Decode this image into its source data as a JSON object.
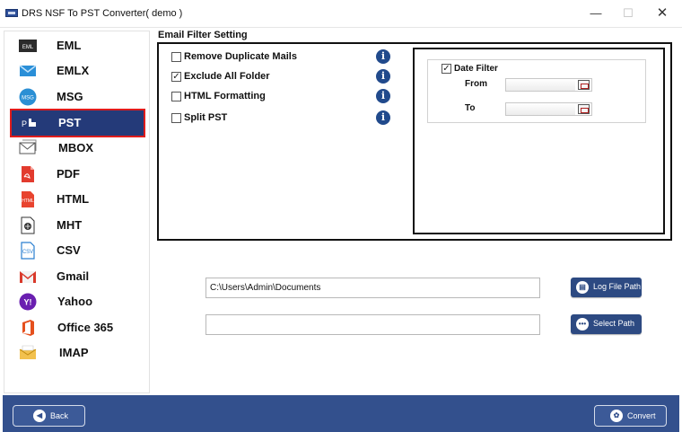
{
  "window": {
    "title": "DRS NSF To PST Converter( demo )",
    "minimize": "—",
    "maximize": "☐",
    "close": "✕"
  },
  "sidebar": {
    "items": [
      {
        "label": "EML",
        "icon": "eml-file-icon"
      },
      {
        "label": "EMLX",
        "icon": "envelope-icon"
      },
      {
        "label": "MSG",
        "icon": "msg-file-icon"
      },
      {
        "label": "PST",
        "icon": "pst-file-icon",
        "selected": true
      },
      {
        "label": "MBOX",
        "icon": "mbox-envelope-icon"
      },
      {
        "label": "PDF",
        "icon": "pdf-file-icon"
      },
      {
        "label": "HTML",
        "icon": "html-file-icon"
      },
      {
        "label": "MHT",
        "icon": "mht-file-icon"
      },
      {
        "label": "CSV",
        "icon": "csv-file-icon"
      },
      {
        "label": "Gmail",
        "icon": "gmail-icon"
      },
      {
        "label": "Yahoo",
        "icon": "yahoo-icon"
      },
      {
        "label": "Office 365",
        "icon": "office365-icon"
      },
      {
        "label": "IMAP",
        "icon": "imap-icon"
      }
    ]
  },
  "filter": {
    "section_title": "Email Filter Setting",
    "options": [
      {
        "label": "Remove Duplicate Mails",
        "checked": false
      },
      {
        "label": "Exclude All Folder",
        "checked": true
      },
      {
        "label": "HTML Formatting",
        "checked": false
      },
      {
        "label": "Split PST",
        "checked": false
      }
    ],
    "info_glyph": "i",
    "date_filter": {
      "label": "Date Filter",
      "checked": true,
      "from_label": "From",
      "to_label": "To",
      "from_value": "",
      "to_value": ""
    }
  },
  "paths": {
    "log_path_value": "C:\\Users\\Admin\\Documents",
    "log_button": "Log File Path",
    "destination_value": "",
    "select_button": "Select Path"
  },
  "footer": {
    "back_label": "Back",
    "convert_label": "Convert"
  },
  "colors": {
    "accent": "#33508d",
    "selected_item": "#243a79",
    "selected_border": "#e01c1c",
    "info_icon": "#214a8c"
  }
}
